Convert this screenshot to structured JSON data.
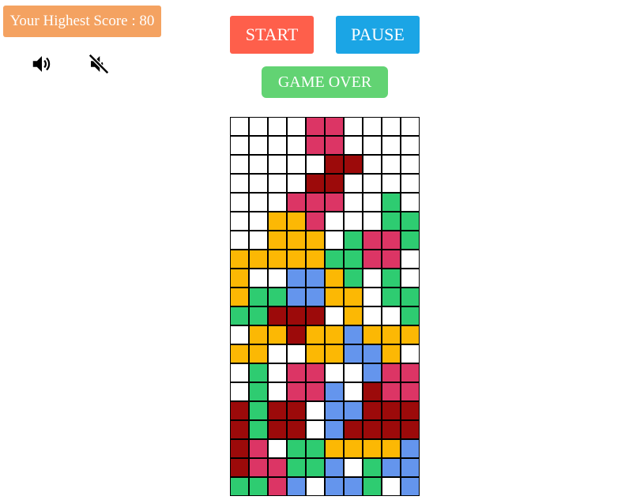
{
  "score": {
    "label": "Your Highest Score : 80"
  },
  "controls": {
    "start_label": "START",
    "pause_label": "PAUSE",
    "gameover_label": "GAME OVER"
  },
  "icons": {
    "sound_on": "speaker-volume-icon",
    "sound_off": "speaker-mute-icon"
  },
  "colors": {
    "score_badge": "#f4a261",
    "start": "#fe5f4b",
    "pause": "#1ba5e5",
    "gameover": "#62d373",
    "W": "#ffffff",
    "P": "#dc3565",
    "R": "#9c0a0a",
    "Y": "#fcb804",
    "G": "#2ecc71",
    "B": "#6495ed"
  },
  "board": {
    "columns": 10,
    "rows": [
      "WWWWPPWWWW",
      "WWWWPPWWWW",
      "WWWWWRRWWW",
      "WWWWRRWWWW",
      "WWWPPPWWGW",
      "WWYYPWWWGG",
      "WWYYYWGPPG",
      "YYYYYGGPPW",
      "YWWBBYGWGW",
      "YGGBBYYWGG",
      "GGRRRWYWWG",
      "WYYRYYBYYY",
      "YYWWYYBBYW",
      "WGWPPWWBPP",
      "WGWPPBWRPP",
      "RGRRWBBRRR",
      "RGRRWBRRRR",
      "RPWGGYYYYB",
      "RPPGGBWGBB",
      "GGPBWBBGWB"
    ]
  }
}
